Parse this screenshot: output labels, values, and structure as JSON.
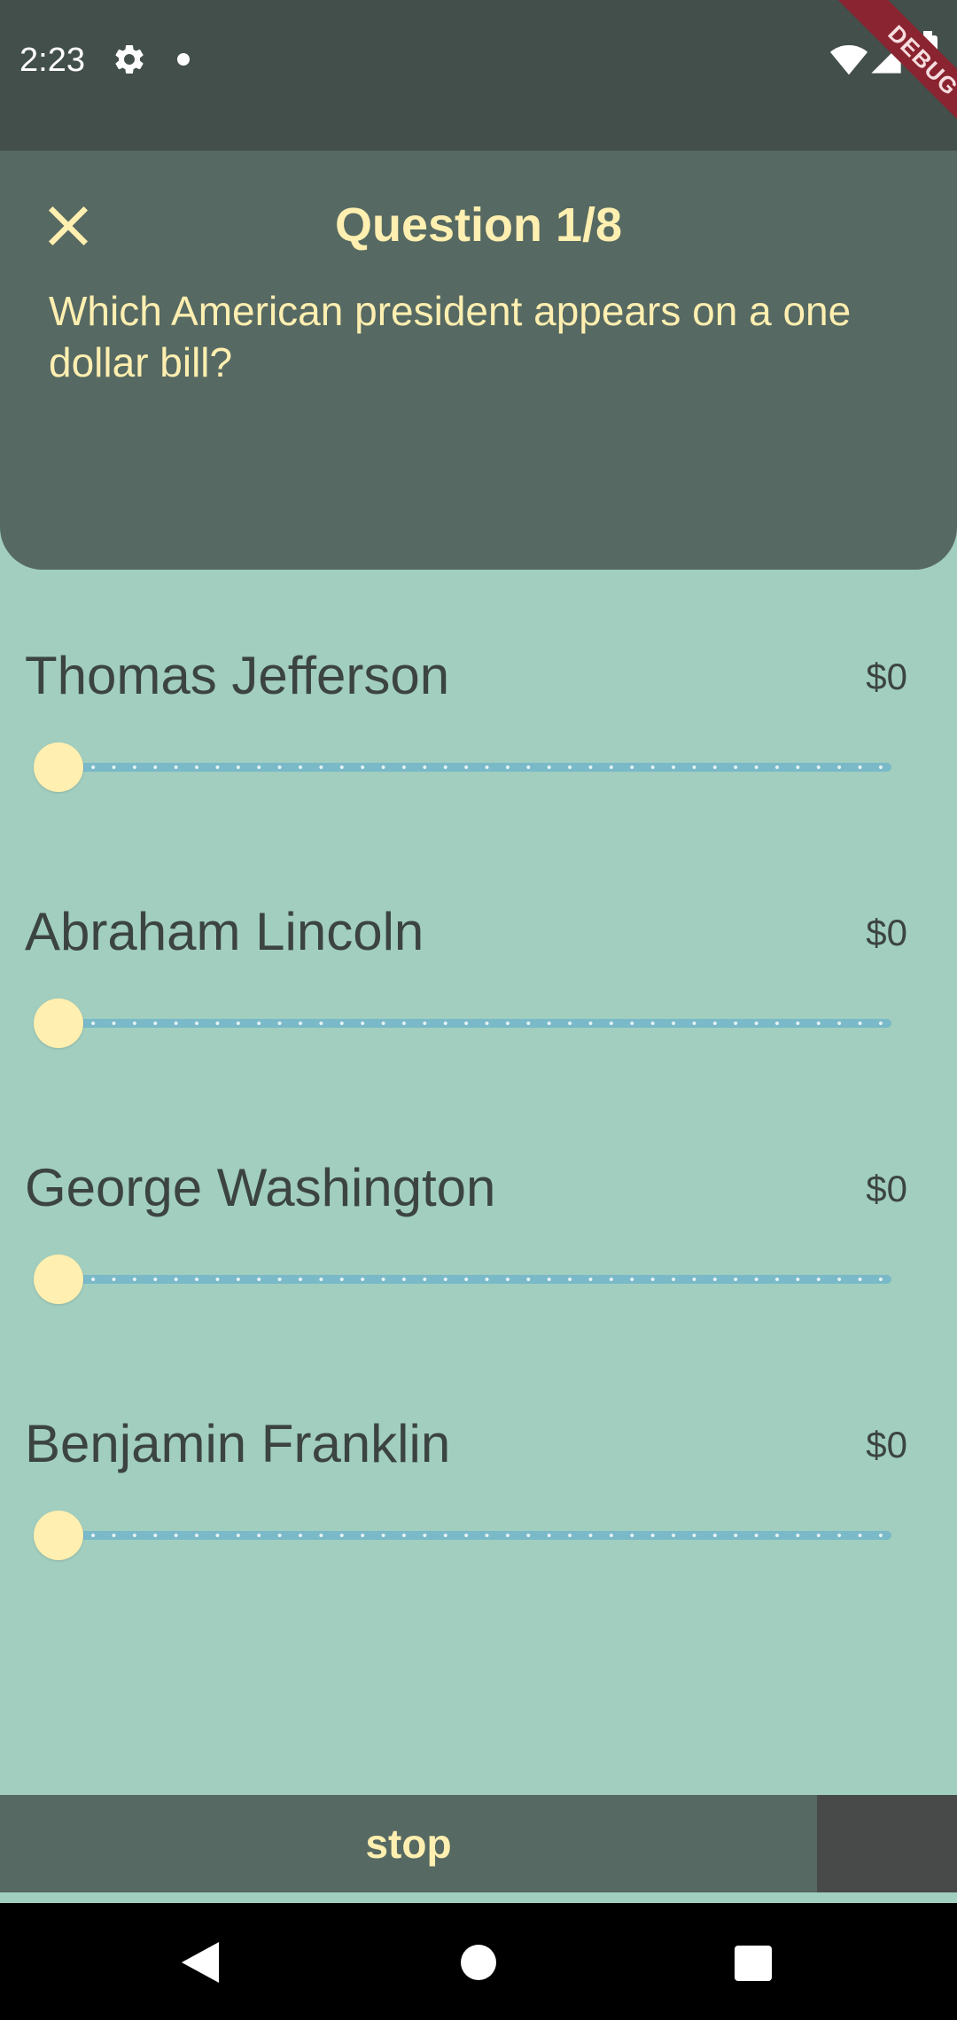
{
  "status_bar": {
    "time": "2:23",
    "icons": [
      "gear-icon",
      "notification-dot-icon",
      "wifi-icon",
      "signal-icon",
      "battery-icon"
    ],
    "debug_label": "DEBUG"
  },
  "header": {
    "close_icon": "close-icon",
    "title": "Question 1/8",
    "question": "Which American president appears on a one dollar bill?"
  },
  "answers": [
    {
      "label": "Thomas Jefferson",
      "amount": "$0",
      "slider_value": 0
    },
    {
      "label": "Abraham Lincoln",
      "amount": "$0",
      "slider_value": 0
    },
    {
      "label": "George Washington",
      "amount": "$0",
      "slider_value": 0
    },
    {
      "label": "Benjamin Franklin",
      "amount": "$0",
      "slider_value": 0
    }
  ],
  "footer": {
    "stop_label": "stop"
  },
  "nav_bar": {
    "icons": [
      "back-icon",
      "home-icon",
      "recents-icon"
    ]
  },
  "colors": {
    "background": "#a1cebf",
    "header": "#566962",
    "accent": "#ffefb0",
    "slider_track": "#7ab9c8",
    "text_dark": "#3c4441"
  }
}
